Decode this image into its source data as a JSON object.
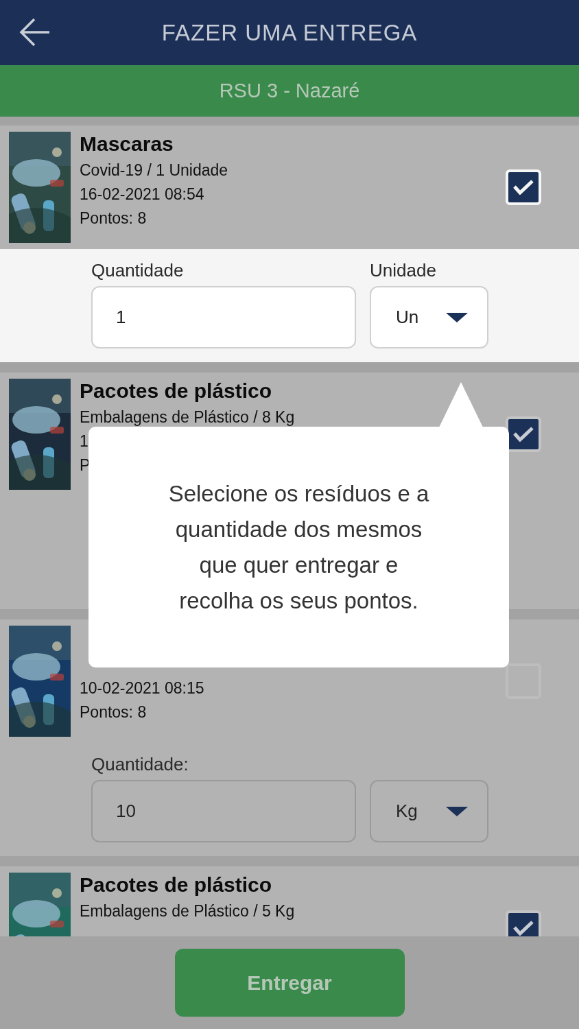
{
  "header": {
    "title": "FAZER UMA ENTREGA"
  },
  "location": {
    "name": "RSU 3 - Nazaré"
  },
  "entries": [
    {
      "kind": "waste",
      "title": "Mascaras",
      "subtitle": "Covid-19 / 1 Unidade",
      "date": "16-02-2021 08:54",
      "points": "Pontos: 8",
      "checked": true
    },
    {
      "kind": "quantity",
      "highlighted": true,
      "label": "Quantidade",
      "value": "1",
      "unit_label": "Unidade",
      "unit": "Un"
    },
    {
      "kind": "waste",
      "title": "Pacotes de plástico",
      "subtitle": "Embalagens de Plástico / 8 Kg",
      "date": "1",
      "points": "P",
      "checked": true
    },
    {
      "kind": "blank"
    },
    {
      "kind": "waste",
      "date": "10-02-2021 08:15",
      "points": "Pontos: 8",
      "checked": false
    },
    {
      "kind": "quantity",
      "highlighted": false,
      "label": "Quantidade:",
      "value": "10",
      "unit": "Kg"
    },
    {
      "kind": "waste",
      "title": "Pacotes de plástico",
      "subtitle": "Embalagens de Plástico / 5 Kg",
      "checked": true
    }
  ],
  "tooltip": {
    "text": "Selecione os resíduos e a quantidade dos mesmos que quer entregar e recolha os seus pontos."
  },
  "footer": {
    "button": "Entregar"
  }
}
